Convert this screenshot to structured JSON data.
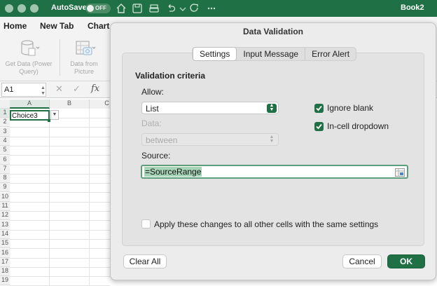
{
  "titlebar": {
    "autosave_label": "AutoSave",
    "autosave_state": "OFF",
    "book_title": "Book2",
    "accent_color": "#1f7044"
  },
  "ribbon_tabs": [
    "Home",
    "New Tab",
    "Chart"
  ],
  "ribbon": {
    "get_data": "Get Data (Power Query)",
    "data_from_picture": "Data from Picture"
  },
  "formula_bar": {
    "name_box": "A1",
    "fx": "fx"
  },
  "grid": {
    "columns": [
      "A",
      "B",
      "C"
    ],
    "rows": [
      "1",
      "2",
      "3",
      "4",
      "5",
      "6",
      "7",
      "8",
      "9",
      "10",
      "11",
      "12",
      "13",
      "14",
      "15",
      "16",
      "17",
      "18",
      "19"
    ],
    "a1_value": "Choice3"
  },
  "dialog": {
    "title": "Data Validation",
    "tabs": [
      "Settings",
      "Input Message",
      "Error Alert"
    ],
    "active_tab": "Settings",
    "section_title": "Validation criteria",
    "allow_label": "Allow:",
    "allow_value": "List",
    "data_label": "Data:",
    "data_value": "between",
    "ignore_blank": "Ignore blank",
    "ignore_blank_checked": true,
    "in_cell_dropdown": "In-cell dropdown",
    "in_cell_dropdown_checked": true,
    "source_label": "Source:",
    "source_value": "=SourceRange",
    "apply_all": "Apply these changes to all other cells with the same settings",
    "apply_all_checked": false,
    "clear_all": "Clear All",
    "cancel": "Cancel",
    "ok": "OK"
  }
}
